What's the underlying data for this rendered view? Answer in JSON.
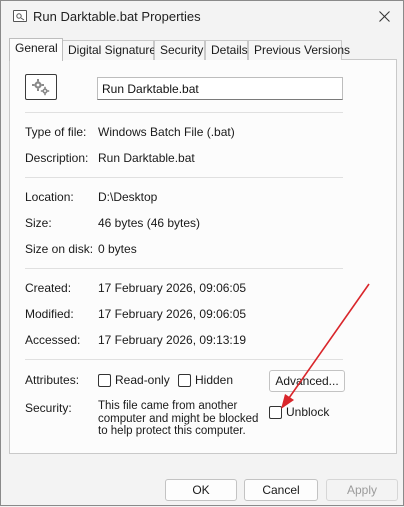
{
  "window": {
    "title": "Run Darktable.bat Properties"
  },
  "tabs": [
    {
      "label": "General",
      "active": true
    },
    {
      "label": "Digital Signatures",
      "active": false
    },
    {
      "label": "Security",
      "active": false
    },
    {
      "label": "Details",
      "active": false
    },
    {
      "label": "Previous Versions",
      "active": false
    }
  ],
  "general": {
    "file_icon": "batch-file-gear-icon",
    "file_name": "Run Darktable.bat",
    "type_label": "Type of file:",
    "type_value": "Windows Batch File (.bat)",
    "description_label": "Description:",
    "description_value": "Run Darktable.bat",
    "location_label": "Location:",
    "location_value": "D:\\Desktop",
    "size_label": "Size:",
    "size_value": "46 bytes (46 bytes)",
    "size_on_disk_label": "Size on disk:",
    "size_on_disk_value": "0 bytes",
    "created_label": "Created:",
    "created_value": "17 February 2026, 09:06:05",
    "modified_label": "Modified:",
    "modified_value": "17 February 2026, 09:06:05",
    "accessed_label": "Accessed:",
    "accessed_value": "17 February 2026, 09:13:19",
    "attributes_label": "Attributes:",
    "readonly_label": "Read-only",
    "readonly_checked": false,
    "hidden_label": "Hidden",
    "hidden_checked": false,
    "advanced_label": "Advanced...",
    "security_label": "Security:",
    "security_text": "This file came from another computer and might be blocked to help protect this computer.",
    "unblock_label": "Unblock",
    "unblock_checked": false
  },
  "buttons": {
    "ok": "OK",
    "cancel": "Cancel",
    "apply": "Apply"
  },
  "colors": {
    "annotation_arrow": "#d9262b"
  }
}
